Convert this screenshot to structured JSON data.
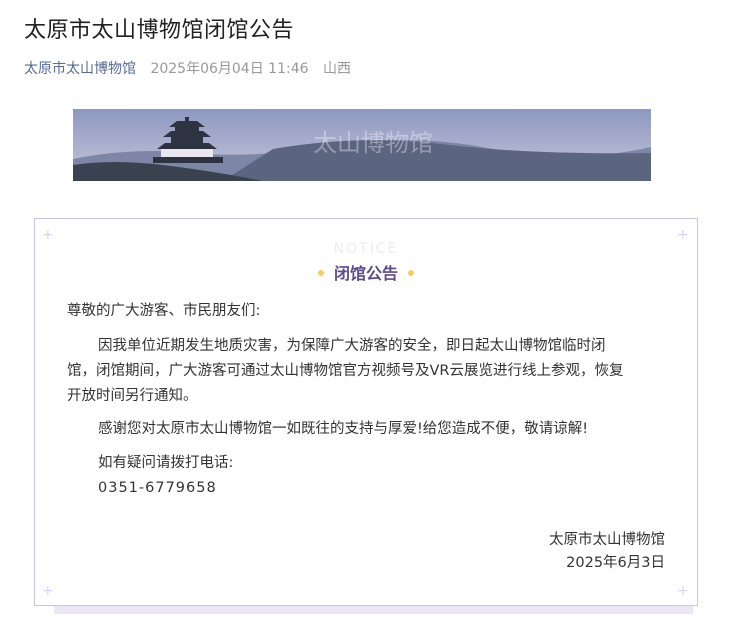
{
  "article": {
    "title": "太原市太山博物馆闭馆公告",
    "author": "太原市太山博物馆",
    "date": "2025年06月04日 11:46",
    "location": "山西"
  },
  "banner": {
    "watermark": "太山博物馆",
    "colors": {
      "sky": "#9aa4c6",
      "mountain": "#5c6580",
      "ground": "#3a4250"
    }
  },
  "notice": {
    "ghost_text": "NOTICE",
    "heading": "闭馆公告",
    "greeting": "尊敬的广大游客、市民朋友们:",
    "body_lines": [
      "因我单位近期发生地质灾害，为保障广大游客的安全，即日起太山博物馆临时闭",
      "馆，闭馆期间，广大游客可通过太山博物馆官方视频号及VR云展览进行线上参观，恢复",
      "开放时间另行通知。"
    ],
    "thanks": "感谢您对太原市太山博物馆一如既往的支持与厚爱!给您造成不便，敬请谅解!",
    "contact_label": "如有疑问请拨打电话:",
    "phone": "0351-6779658",
    "signature": "太原市太山博物馆",
    "sign_date": "2025年6月3日",
    "colors": {
      "accent": "#5a4b8c",
      "dot": "#f2cf5c",
      "border": "#c9c3ea"
    }
  }
}
